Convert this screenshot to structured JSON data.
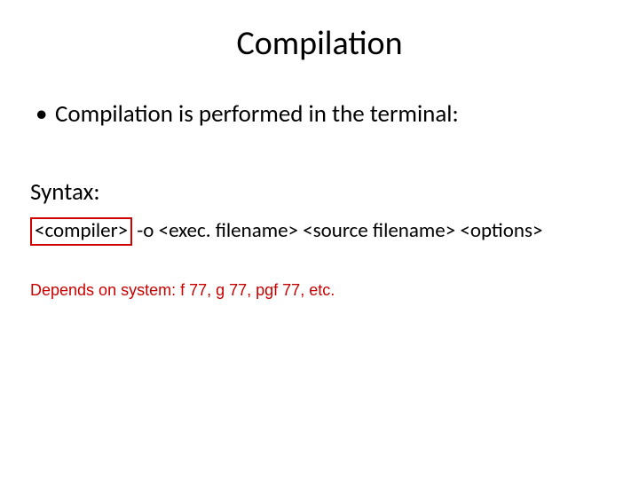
{
  "title": "Compilation",
  "bullet1": "Compilation is performed in the terminal:",
  "syntaxLabel": "Syntax:",
  "syntax": {
    "compiler": "<compiler>",
    "rest": " -o <exec. filename> <source filename> <options>"
  },
  "depends": "Depends on system: f 77, g 77, pgf 77, etc."
}
